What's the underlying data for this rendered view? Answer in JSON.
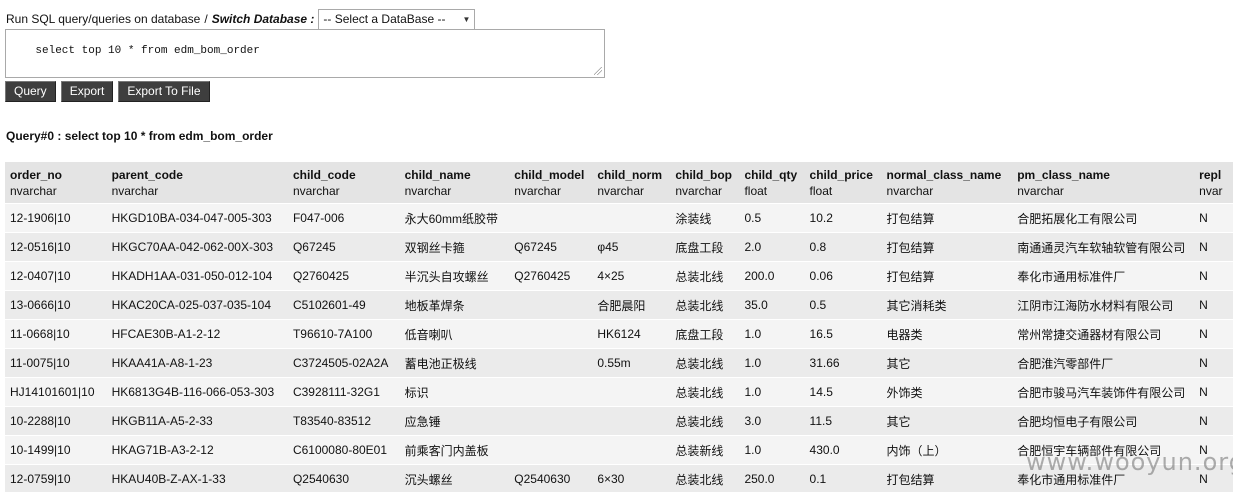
{
  "header": {
    "run_label": "Run SQL query/queries on database",
    "separator": "/",
    "switch_label": "Switch Database :",
    "db_select": "-- Select a DataBase --"
  },
  "sql": {
    "text": "select top 10 * from edm_bom_order"
  },
  "buttons": {
    "query": "Query",
    "export": "Export",
    "export_file": "Export To File"
  },
  "result": {
    "title": "Query#0 : select top 10 * from edm_bom_order",
    "columns": [
      {
        "name": "order_no",
        "type": "nvarchar"
      },
      {
        "name": "parent_code",
        "type": "nvarchar"
      },
      {
        "name": "child_code",
        "type": "nvarchar"
      },
      {
        "name": "child_name",
        "type": "nvarchar"
      },
      {
        "name": "child_model",
        "type": "nvarchar"
      },
      {
        "name": "child_norm",
        "type": "nvarchar"
      },
      {
        "name": "child_bop",
        "type": "nvarchar"
      },
      {
        "name": "child_qty",
        "type": "float"
      },
      {
        "name": "child_price",
        "type": "float"
      },
      {
        "name": "normal_class_name",
        "type": "nvarchar"
      },
      {
        "name": "pm_class_name",
        "type": "nvarchar"
      },
      {
        "name": "repl",
        "type": "nvar"
      }
    ],
    "rows": [
      [
        "12-1906|10",
        "HKGD10BA-034-047-005-303",
        "F047-006",
        "永大60mm纸胶带",
        "",
        "",
        "涂装线",
        "0.5",
        "10.2",
        "打包结算",
        "合肥拓展化工有限公司",
        "N"
      ],
      [
        "12-0516|10",
        "HKGC70AA-042-062-00X-303",
        "Q67245",
        "双钢丝卡箍",
        "Q67245",
        "φ45",
        "底盘工段",
        "2.0",
        "0.8",
        "打包结算",
        "南通通灵汽车软轴软管有限公司",
        "N"
      ],
      [
        "12-0407|10",
        "HKADH1AA-031-050-012-104",
        "Q2760425",
        "半沉头自攻螺丝",
        "Q2760425",
        "4×25",
        "总装北线",
        "200.0",
        "0.06",
        "打包结算",
        "奉化市通用标准件厂",
        "N"
      ],
      [
        "13-0666|10",
        "HKAC20CA-025-037-035-104",
        "C5102601-49",
        "地板革焊条",
        "",
        "合肥晨阳",
        "总装北线",
        "35.0",
        "0.5",
        "其它消耗类",
        "江阴市江海防水材料有限公司",
        "N"
      ],
      [
        "11-0668|10",
        "HFCAE30B-A1-2-12",
        "T96610-7A100",
        "低音喇叭",
        "",
        "HK6124",
        "底盘工段",
        "1.0",
        "16.5",
        "电器类",
        "常州常捷交通器材有限公司",
        "N"
      ],
      [
        "11-0075|10",
        "HKAA41A-A8-1-23",
        "C3724505-02A2A",
        "蓄电池正极线",
        "",
        "0.55m",
        "总装北线",
        "1.0",
        "31.66",
        "其它",
        "合肥淮汽零部件厂",
        "N"
      ],
      [
        "HJ14101601|10",
        "HK6813G4B-116-066-053-303",
        "C3928111-32G1",
        "标识",
        "",
        "",
        "总装北线",
        "1.0",
        "14.5",
        "外饰类",
        "合肥市骏马汽车装饰件有限公司",
        "N"
      ],
      [
        "10-2288|10",
        "HKGB11A-A5-2-33",
        "T83540-83512",
        "应急锤",
        "",
        "",
        "总装北线",
        "3.0",
        "11.5",
        "其它",
        "合肥均恒电子有限公司",
        "N"
      ],
      [
        "10-1499|10",
        "HKAG71B-A3-2-12",
        "C6100080-80E01",
        "前乘客门内盖板",
        "",
        "",
        "总装新线",
        "1.0",
        "430.0",
        "内饰（上）",
        "合肥恒宇车辆部件有限公司",
        "N"
      ],
      [
        "12-0759|10",
        "HKAU40B-Z-AX-1-33",
        "Q2540630",
        "沉头螺丝",
        "Q2540630",
        "6×30",
        "总装北线",
        "250.0",
        "0.1",
        "打包结算",
        "奉化市通用标准件厂",
        "N"
      ]
    ]
  },
  "watermark": "www.wooyun.org"
}
